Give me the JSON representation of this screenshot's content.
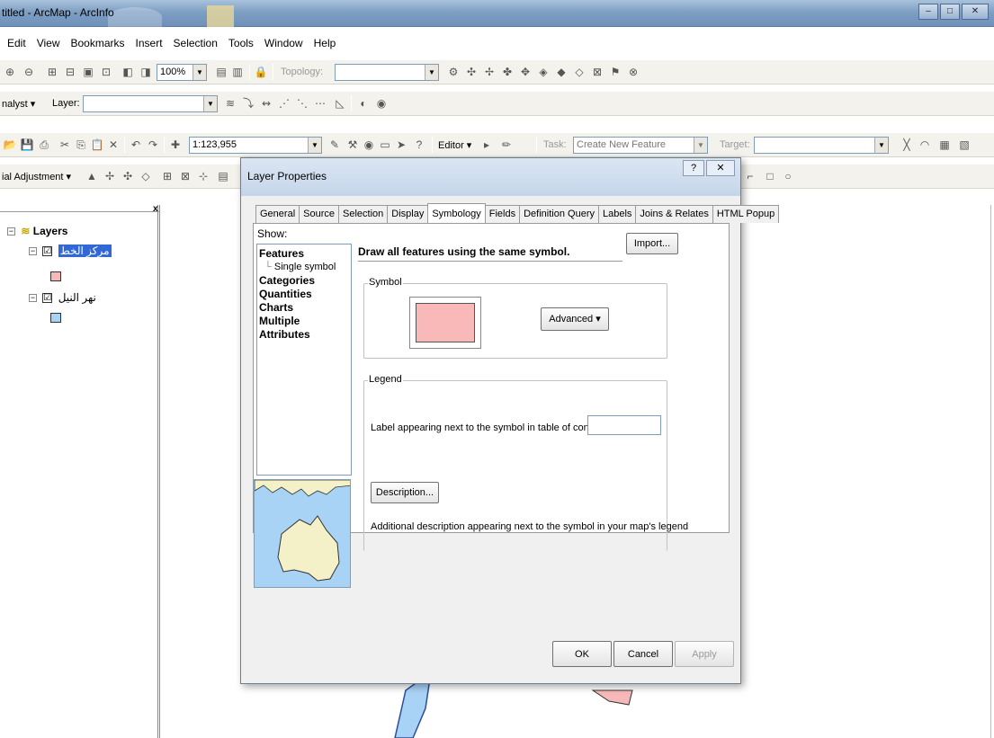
{
  "window": {
    "title": "titled - ArcMap - ArcInfo",
    "min_glyph": "–",
    "max_glyph": "□",
    "close_glyph": "✕"
  },
  "menu": [
    "Edit",
    "View",
    "Bookmarks",
    "Insert",
    "Selection",
    "Tools",
    "Window",
    "Help"
  ],
  "toolbar1": {
    "zoom_value": "100%",
    "topology_label": "Topology:"
  },
  "toolbar2": {
    "analyst_label": "nalyst ▾",
    "layer_label": "Layer:"
  },
  "toolbar3": {
    "scale_value": "1:123,955",
    "editor_label": "Editor ▾",
    "task_label": "Task:",
    "task_value": "Create New Feature",
    "target_label": "Target:"
  },
  "toolbar4": {
    "spatial_label": "ial Adjustment ▾"
  },
  "toc": {
    "root_label": "Layers",
    "layers": [
      {
        "name": "مركز الخط",
        "checked": "☑",
        "swatch_color": "#f6b8b8"
      },
      {
        "name": "نهر النيل",
        "checked": "☑",
        "swatch_color": "#a9d3f5"
      }
    ],
    "close_glyph": "x"
  },
  "dialog": {
    "title": "Layer Properties",
    "help_glyph": "?",
    "close_glyph": "✕",
    "tabs": [
      "General",
      "Source",
      "Selection",
      "Display",
      "Symbology",
      "Fields",
      "Definition Query",
      "Labels",
      "Joins & Relates",
      "HTML Popup"
    ],
    "active_tab": "Symbology",
    "show_label": "Show:",
    "show_items": [
      {
        "label": "Features",
        "type": "header"
      },
      {
        "label": "Single symbol",
        "type": "sub"
      },
      {
        "label": "Categories",
        "type": "header"
      },
      {
        "label": "Quantities",
        "type": "header"
      },
      {
        "label": "Charts",
        "type": "header"
      },
      {
        "label": "Multiple Attributes",
        "type": "header"
      }
    ],
    "description": "Draw all features using the same symbol.",
    "import_button": "Import...",
    "symbol_group": "Symbol",
    "symbol_fill_color": "#f9b9b9",
    "advanced_button": "Advanced ▾",
    "legend_group": "Legend",
    "legend_label": "Label appearing next to the symbol in table of contents:",
    "legend_value": "",
    "description_button": "Description...",
    "additional_desc": "Additional description appearing next to the symbol in your map's legend",
    "ok_button": "OK",
    "cancel_button": "Cancel",
    "apply_button": "Apply"
  },
  "colors": {
    "titlebar": "#7f9fc4",
    "highlight": "#3168d5",
    "river_fill": "#a9d3f5",
    "polygon_fill": "#f6b8b8"
  }
}
